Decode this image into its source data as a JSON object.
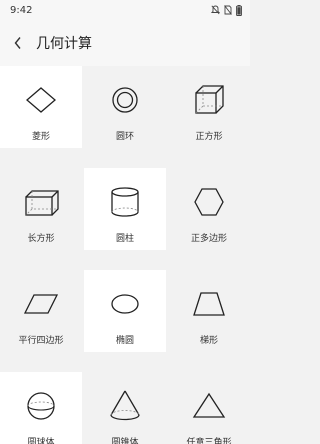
{
  "status_bar": {
    "time": "9:42"
  },
  "app_bar": {
    "title": "几何计算"
  },
  "items": [
    {
      "label": "菱形",
      "icon": "rhombus-icon"
    },
    {
      "label": "圆环",
      "icon": "annulus-icon"
    },
    {
      "label": "正方形",
      "icon": "cube-icon"
    },
    {
      "label": "长方形",
      "icon": "cuboid-icon"
    },
    {
      "label": "圆柱",
      "icon": "cylinder-icon"
    },
    {
      "label": "正多边形",
      "icon": "hexagon-icon"
    },
    {
      "label": "平行四边形",
      "icon": "parallelogram-icon"
    },
    {
      "label": "椭圆",
      "icon": "ellipse-icon"
    },
    {
      "label": "梯形",
      "icon": "trapezoid-icon"
    },
    {
      "label": "圆球体",
      "icon": "sphere-icon"
    },
    {
      "label": "圆锥体",
      "icon": "cone-icon"
    },
    {
      "label": "任意三角形",
      "icon": "triangle-icon"
    }
  ]
}
